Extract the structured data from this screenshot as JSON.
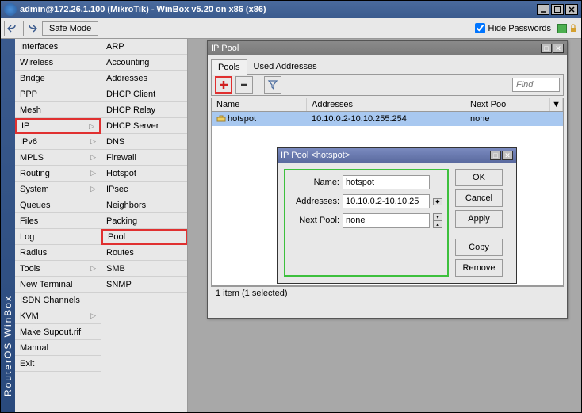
{
  "window": {
    "title": "admin@172.26.1.100 (MikroTik) - WinBox v5.20 on x86 (x86)"
  },
  "toolbar": {
    "safe_mode": "Safe Mode",
    "hide_passwords": "Hide Passwords",
    "hide_passwords_checked": true
  },
  "sidebar_label": "RouterOS  WinBox",
  "menu": [
    {
      "label": "Interfaces",
      "sub": false
    },
    {
      "label": "Wireless",
      "sub": false
    },
    {
      "label": "Bridge",
      "sub": false
    },
    {
      "label": "PPP",
      "sub": false
    },
    {
      "label": "Mesh",
      "sub": false
    },
    {
      "label": "IP",
      "sub": true,
      "hl": true
    },
    {
      "label": "IPv6",
      "sub": true
    },
    {
      "label": "MPLS",
      "sub": true
    },
    {
      "label": "Routing",
      "sub": true
    },
    {
      "label": "System",
      "sub": true
    },
    {
      "label": "Queues",
      "sub": false
    },
    {
      "label": "Files",
      "sub": false
    },
    {
      "label": "Log",
      "sub": false
    },
    {
      "label": "Radius",
      "sub": false
    },
    {
      "label": "Tools",
      "sub": true
    },
    {
      "label": "New Terminal",
      "sub": false
    },
    {
      "label": "ISDN Channels",
      "sub": false
    },
    {
      "label": "KVM",
      "sub": true
    },
    {
      "label": "Make Supout.rif",
      "sub": false
    },
    {
      "label": "Manual",
      "sub": false
    },
    {
      "label": "Exit",
      "sub": false
    }
  ],
  "submenu": [
    {
      "label": "ARP"
    },
    {
      "label": "Accounting"
    },
    {
      "label": "Addresses"
    },
    {
      "label": "DHCP Client"
    },
    {
      "label": "DHCP Relay"
    },
    {
      "label": "DHCP Server"
    },
    {
      "label": "DNS"
    },
    {
      "label": "Firewall"
    },
    {
      "label": "Hotspot"
    },
    {
      "label": "IPsec"
    },
    {
      "label": "Neighbors"
    },
    {
      "label": "Packing"
    },
    {
      "label": "Pool",
      "hl": true
    },
    {
      "label": "Routes"
    },
    {
      "label": "SMB"
    },
    {
      "label": "SNMP"
    }
  ],
  "ippool": {
    "title": "IP Pool",
    "tabs": [
      "Pools",
      "Used Addresses"
    ],
    "active_tab": 0,
    "find_placeholder": "Find",
    "columns": {
      "name": "Name",
      "addresses": "Addresses",
      "next": "Next Pool"
    },
    "rows": [
      {
        "name": "hotspot",
        "addresses": "10.10.0.2-10.10.255.254",
        "next": "none"
      }
    ],
    "status": "1 item (1 selected)"
  },
  "dialog": {
    "title": "IP Pool <hotspot>",
    "fields": {
      "name_label": "Name:",
      "name_value": "hotspot",
      "addr_label": "Addresses:",
      "addr_value": "10.10.0.2-10.10.25",
      "next_label": "Next Pool:",
      "next_value": "none"
    },
    "buttons": {
      "ok": "OK",
      "cancel": "Cancel",
      "apply": "Apply",
      "copy": "Copy",
      "remove": "Remove"
    }
  }
}
